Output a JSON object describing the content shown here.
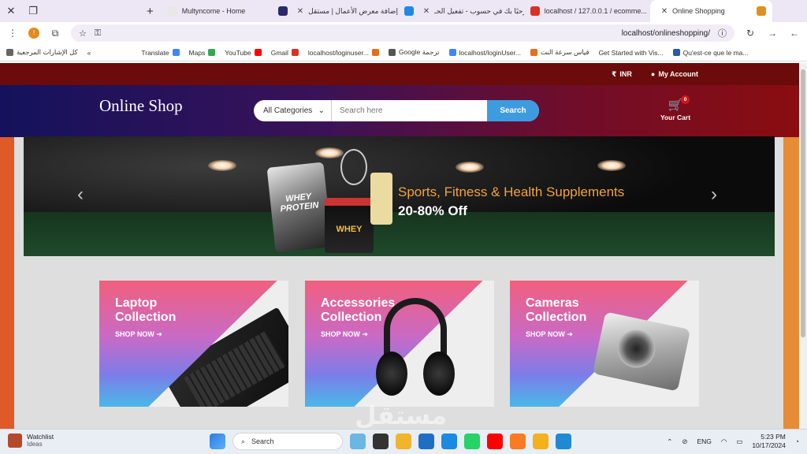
{
  "browser": {
    "tabs": [
      {
        "label": "Multyncome - Home",
        "favicon_color": "#e8e8e8",
        "active": false
      },
      {
        "label": "إضافة معرض الأعمال | مستقل",
        "favicon_color": "#2a2a6a",
        "active": false
      },
      {
        "label": "مرحبًا بك في حسوب - تفعيل الحـ...",
        "favicon_color": "#1e88e5",
        "active": false
      },
      {
        "label": "localhost / 127.0.0.1 / ecomme...",
        "favicon_color": "#d93025",
        "active": false
      },
      {
        "label": "Online Shopping",
        "favicon_color": "#e09020",
        "active": true
      }
    ],
    "url": "localhost/onlineshopping/",
    "bookmarks": [
      {
        "label": "كل الإشارات المرجعية",
        "color": "#666666"
      },
      {
        "label": "Translate",
        "color": "#4285f4"
      },
      {
        "label": "Maps",
        "color": "#34a853"
      },
      {
        "label": "YouTube",
        "color": "#ff0000"
      },
      {
        "label": "Gmail",
        "color": "#d93025"
      },
      {
        "label": "localhost/loginuser...",
        "color": "#e07020"
      },
      {
        "label": "Google ترجمة",
        "color": "#555555"
      },
      {
        "label": "localhost/loginUser...",
        "color": "#4285f4"
      },
      {
        "label": "قياس سرعة النت",
        "color": "#e07020"
      },
      {
        "label": "Get Started with Vis...",
        "color": "#d93025"
      },
      {
        "label": "Qu'est-ce que le ma...",
        "color": "#2d5aa6"
      }
    ]
  },
  "shop": {
    "topbar": {
      "currency": "INR",
      "account": "My Account"
    },
    "logo": "Online Shop",
    "search": {
      "category": "All Categories",
      "placeholder": "Search here",
      "button": "Search"
    },
    "cart": {
      "label": "Your Cart",
      "count": "0"
    },
    "hero": {
      "line1": "Sports, Fitness & Health Supplements",
      "line2": "20-80% Off",
      "bag_text": "WHEY PROTEIN",
      "tub_text": "WHEY"
    },
    "collections": [
      {
        "title": "Laptop Collection",
        "cta": "SHOP NOW"
      },
      {
        "title": "Accessories Collection",
        "cta": "SHOP NOW"
      },
      {
        "title": "Cameras Collection",
        "cta": "SHOP NOW"
      }
    ],
    "watermark": "مستقل"
  },
  "taskbar": {
    "widget_title": "Watchlist",
    "widget_sub": "Ideas",
    "search": "Search",
    "lang": "ENG",
    "time": "5:23 PM",
    "date": "10/17/2024"
  }
}
